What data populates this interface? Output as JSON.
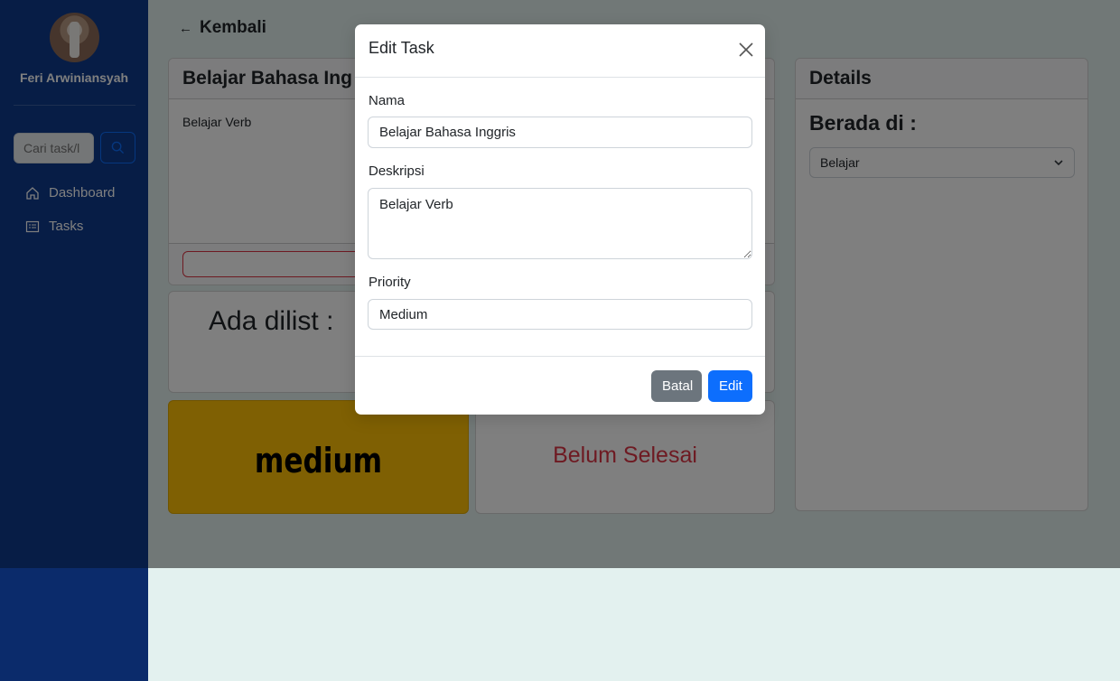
{
  "sidebar": {
    "username": "Feri Arwiniansyah",
    "search_placeholder": "Cari task/l",
    "nav": [
      {
        "label": "Dashboard",
        "icon": "home-icon"
      },
      {
        "label": "Tasks",
        "icon": "list-icon"
      }
    ]
  },
  "main": {
    "back_label": "Kembali",
    "task_title": "Belajar Bahasa Ing",
    "task_description": "Belajar Verb",
    "list_label": "Ada dilist :",
    "priority_badge": "medium",
    "status_text": "Belum Selesai",
    "details": {
      "title": "Details",
      "located_label": "Berada di :",
      "located_value": "Belajar"
    }
  },
  "modal": {
    "title": "Edit Task",
    "name_label": "Nama",
    "name_value": "Belajar Bahasa Inggris",
    "desc_label": "Deskripsi",
    "desc_value": "Belajar Verb",
    "priority_label": "Priority",
    "priority_value": "Medium",
    "cancel_label": "Batal",
    "edit_label": "Edit"
  },
  "colors": {
    "sidebar": "#0e3a8c",
    "primary": "#0d6efd",
    "secondary": "#6c757d",
    "warning": "#ffc107",
    "danger": "#dc3545",
    "page_bg": "#e3f1ef"
  }
}
